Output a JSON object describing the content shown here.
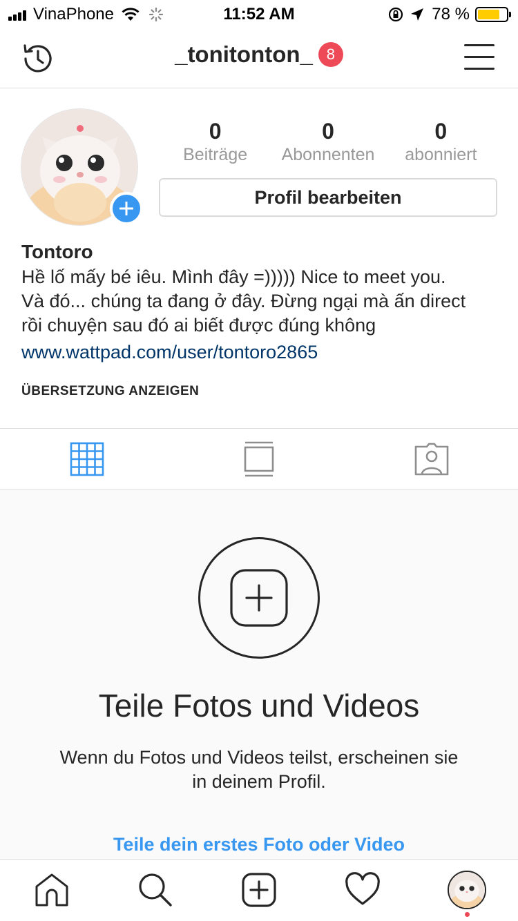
{
  "status_bar": {
    "carrier": "VinaPhone",
    "time": "11:52 AM",
    "battery_percent": "78 %",
    "battery_level": 0.78
  },
  "header": {
    "username": "_tonitonton_",
    "notification_count": "8",
    "icons": {
      "left": "history-icon",
      "right": "menu-icon"
    }
  },
  "profile": {
    "stats": [
      {
        "value": "0",
        "label": "Beiträge"
      },
      {
        "value": "0",
        "label": "Abonnenten"
      },
      {
        "value": "0",
        "label": "abonniert"
      }
    ],
    "edit_button": "Profil bearbeiten",
    "name": "Tontoro",
    "bio_lines": [
      "Hề lố mấy bé iêu. Mình đây =))))) Nice to meet you.",
      "Và đó... chúng ta đang ở đây. Đừng ngại mà ấn direct",
      "rồi chuyện sau đó ai biết được đúng không"
    ],
    "website": "www.wattpad.com/user/tontoro2865",
    "translate_label": "ÜBERSETZUNG ANZEIGEN"
  },
  "tabs": [
    {
      "icon": "grid-icon",
      "active": true
    },
    {
      "icon": "feed-icon",
      "active": false
    },
    {
      "icon": "tagged-icon",
      "active": false
    }
  ],
  "empty_state": {
    "heading": "Teile Fotos und Videos",
    "description": "Wenn du Fotos und Videos teilst, erscheinen sie in deinem Profil.",
    "cta": "Teile dein erstes Foto oder Video"
  },
  "bottom_nav": [
    "home-icon",
    "search-icon",
    "new-post-icon",
    "heart-icon",
    "profile-avatar"
  ],
  "colors": {
    "accent_blue": "#3897f0",
    "badge_red": "#ed4956",
    "link_dark_blue": "#003569",
    "battery_yellow": "#ffcc00"
  }
}
